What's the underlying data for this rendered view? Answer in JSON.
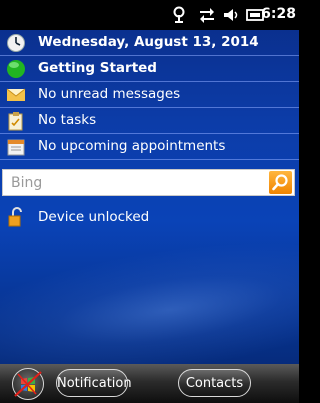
{
  "status_bar": {
    "icons": [
      "antenna-icon",
      "data-transfer-icon",
      "speaker-icon",
      "battery-icon"
    ],
    "time": "6:28"
  },
  "today": {
    "date": "Wednesday, August 13, 2014",
    "getting_started": "Getting Started",
    "messages": "No unread messages",
    "tasks": "No tasks",
    "appointments": "No upcoming appointments"
  },
  "search": {
    "placeholder": "Bing"
  },
  "lock": {
    "status": "Device unlocked"
  },
  "softkeys": {
    "left": "Notification",
    "right": "Contacts"
  },
  "colors": {
    "search_button": "#f59a00",
    "accent_orange": "#f08400",
    "status_green": "#21b521"
  }
}
